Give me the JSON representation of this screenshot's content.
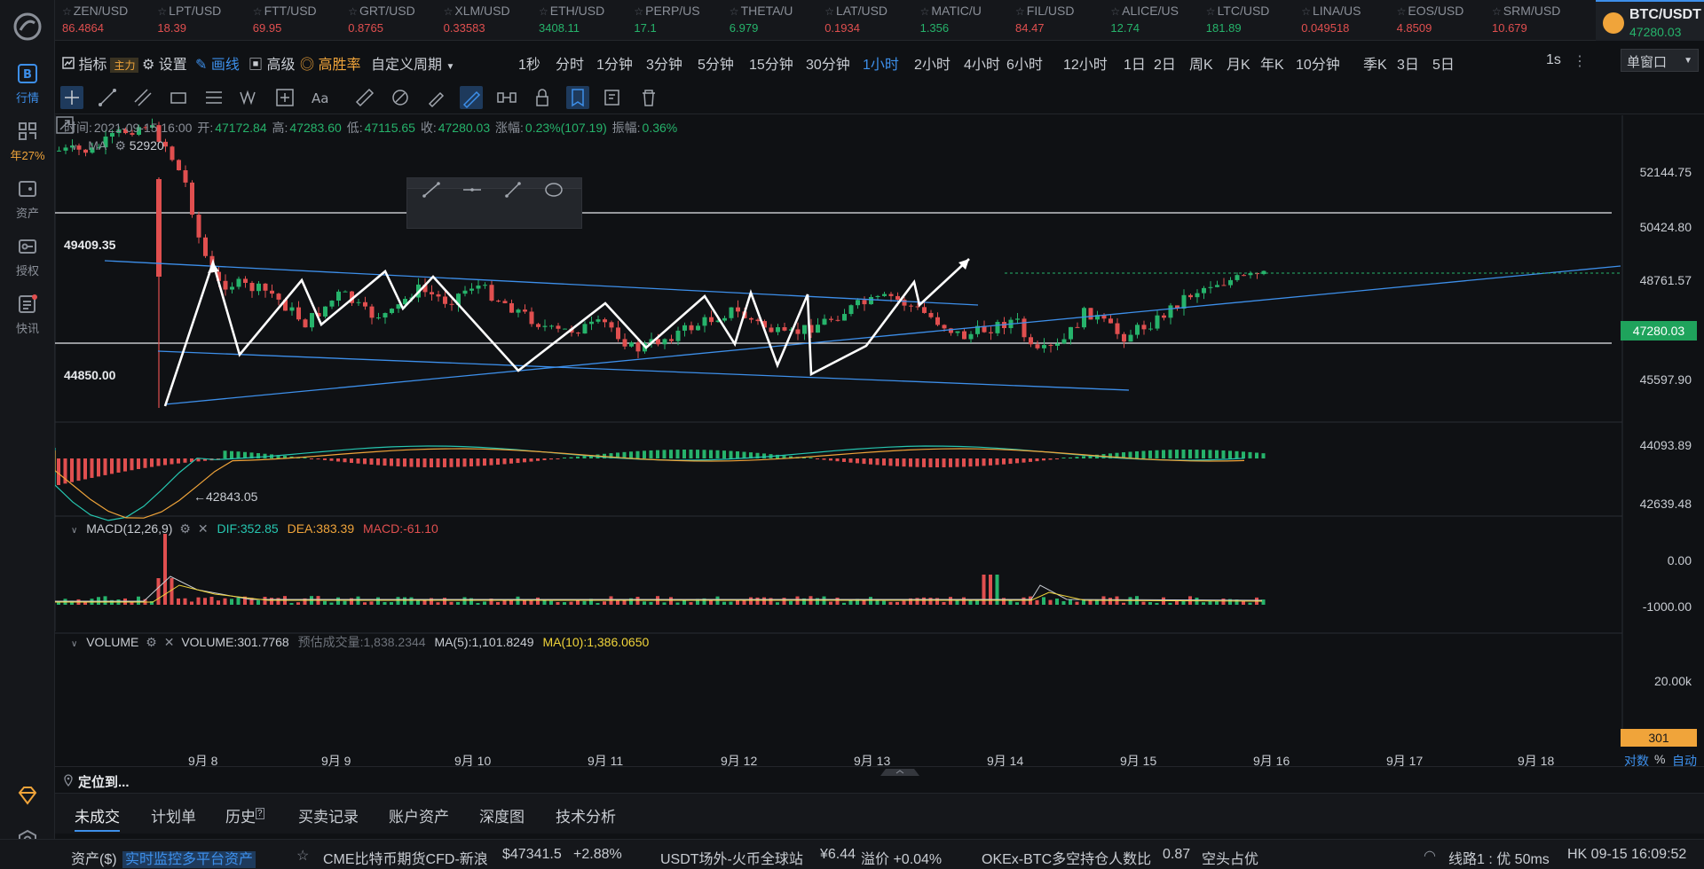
{
  "nav": {
    "items": [
      {
        "label": "行情",
        "icon": "b-icon",
        "active": true
      },
      {
        "label": "年27%",
        "icon": "grid-icon"
      },
      {
        "label": "资产",
        "icon": "wallet-icon"
      },
      {
        "label": "授权",
        "icon": "key-icon"
      },
      {
        "label": "快讯",
        "icon": "news-icon"
      }
    ]
  },
  "tickers": [
    {
      "name": "ZEN/USD",
      "price": "86.4864",
      "dir": "dn"
    },
    {
      "name": "LPT/USD",
      "price": "18.39",
      "dir": "dn"
    },
    {
      "name": "FTT/USD",
      "price": "69.95",
      "dir": "dn"
    },
    {
      "name": "GRT/USD",
      "price": "0.8765",
      "dir": "dn"
    },
    {
      "name": "XLM/USD",
      "price": "0.33583",
      "dir": "dn"
    },
    {
      "name": "ETH/USD",
      "price": "3408.11",
      "dir": "up"
    },
    {
      "name": "PERP/US",
      "price": "17.1",
      "dir": "up"
    },
    {
      "name": "THETA/U",
      "price": "6.979",
      "dir": "up"
    },
    {
      "name": "LAT/USD",
      "price": "0.1934",
      "dir": "dn"
    },
    {
      "name": "MATIC/U",
      "price": "1.356",
      "dir": "up"
    },
    {
      "name": "FIL/USD",
      "price": "84.47",
      "dir": "dn"
    },
    {
      "name": "ALICE/US",
      "price": "12.74",
      "dir": "up"
    },
    {
      "name": "LTC/USD",
      "price": "181.89",
      "dir": "up"
    },
    {
      "name": "LINA/US",
      "price": "0.049518",
      "dir": "dn"
    },
    {
      "name": "EOS/USD",
      "price": "4.8509",
      "dir": "dn"
    },
    {
      "name": "SRM/USD",
      "price": "10.679",
      "dir": "dn"
    }
  ],
  "active_ticker": {
    "name": "BTC/USDT",
    "price": "47280.03"
  },
  "toolbar": {
    "indicator": "指标",
    "indicator_tag": "主力",
    "settings": "设置",
    "draw": "画线",
    "advanced": "高级",
    "win_rate": "高胜率",
    "custom_period": "自定义周期",
    "periods": [
      "1秒",
      "分时",
      "1分钟",
      "3分钟",
      "5分钟",
      "15分钟",
      "30分钟",
      "1小时",
      "2小时",
      "4小时",
      "6小时",
      "12小时",
      "1日",
      "2日",
      "周K",
      "月K",
      "年K",
      "10分钟",
      "季K",
      "3日",
      "5日"
    ],
    "active_period": "1小时",
    "interval": "1s",
    "window": "单窗口"
  },
  "ohlc": {
    "time_label": "时间:",
    "time": "2021-09-15 16:00",
    "open_label": "开:",
    "open": "47172.84",
    "high_label": "高:",
    "high": "47283.60",
    "low_label": "低:",
    "low": "47115.65",
    "close_label": "收:",
    "close": "47280.03",
    "chg_label": "涨幅:",
    "chg": "0.23%(107.19)",
    "amp_label": "振幅:",
    "amp": "0.36%"
  },
  "ma_label": "MA",
  "ma_value": "52920",
  "price_axis": [
    "52144.75",
    "50424.80",
    "48761.57",
    "45597.90",
    "44093.89",
    "42639.48"
  ],
  "last_price": "47280.03",
  "hlines": {
    "upper": "49409.35",
    "lower": "44850.00"
  },
  "low_marker": "42843.05",
  "macd": {
    "title": "MACD(12,26,9)",
    "dif": "DIF:352.85",
    "dea": "DEA:383.39",
    "macd": "MACD:-61.10",
    "axis": [
      "0.00",
      "-1000.00"
    ]
  },
  "volume": {
    "title": "VOLUME",
    "value": "VOLUME:301.7768",
    "est": "预估成交量:1,838.2344",
    "ma5": "MA(5):1,101.8249",
    "ma10": "MA(10):1,386.0650",
    "axis": "20.00k",
    "tag": "301"
  },
  "x_axis": [
    "9月 8",
    "9月 9",
    "9月 10",
    "9月 11",
    "9月 12",
    "9月 13",
    "9月 14",
    "9月 15",
    "9月 16",
    "9月 17",
    "9月 18"
  ],
  "axis_modes": {
    "log": "对数",
    "pct": "%",
    "auto": "自动"
  },
  "locate": "定位到...",
  "bottom_tabs": [
    "未成交",
    "计划单",
    "历史",
    "买卖记录",
    "账户资产",
    "深度图",
    "技术分析"
  ],
  "status": {
    "assets": "资产($)",
    "monitor": "实时监控多平台资产",
    "cme_label": "CME比特币期货CFD-新浪",
    "cme_price": "$47341.5",
    "cme_chg": "+2.88%",
    "usdt_label": "USDT场外-火币全球站",
    "usdt_price": "¥6.44",
    "premium": "溢价 +0.04%",
    "okex_label": "OKEx-BTC多空持仓人数比",
    "okex_value": "0.87",
    "okex_state": "空头占优",
    "line": "线路1 : 优 50ms",
    "clock": "HK 09-15 16:09:52"
  },
  "colors": {
    "up": "#26b36b",
    "down": "#e04f4f",
    "accent": "#3d8fea",
    "orange": "#f0a43a"
  }
}
